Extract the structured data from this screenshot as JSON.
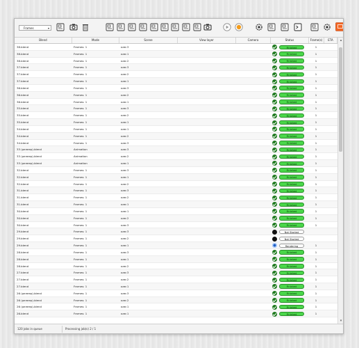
{
  "toolbar": {
    "dropdown_value": "Frames",
    "icons": [
      "add-job-icon",
      "add-folder-icon",
      "delete-icon",
      "clear-icon",
      "select-blend-icon",
      "edit-scene-icon",
      "render-settings-icon",
      "output-folder-icon",
      "image-format-icon",
      "frame-range-icon",
      "samples-icon",
      "split-icon",
      "camera-icon",
      "play-icon",
      "stop-icon",
      "settings-icon",
      "log-icon",
      "report-icon",
      "terminal-icon",
      "preview-icon",
      "folder-open-icon",
      "render-device-icon"
    ]
  },
  "table": {
    "headers": [
      "Blend",
      "Mode",
      "Scene",
      "View layer",
      "Camera",
      "Status",
      "Frame(s)",
      "ETA"
    ],
    "rows": [
      {
        "blend": "38.blend",
        "mode": "Frames: 1",
        "scene": "кам 3",
        "status": "Finished",
        "frames": "1"
      },
      {
        "blend": "38.blend",
        "mode": "Frames: 1",
        "scene": "кам 1",
        "status": "Finished",
        "frames": "1"
      },
      {
        "blend": "38.blend",
        "mode": "Frames: 1",
        "scene": "кам 2",
        "status": "Finished",
        "frames": "1"
      },
      {
        "blend": "37.blend",
        "mode": "Frames: 1",
        "scene": "кам 3",
        "status": "Finished",
        "frames": "1"
      },
      {
        "blend": "37.blend",
        "mode": "Frames: 1",
        "scene": "кам 2",
        "status": "Finished",
        "frames": "1"
      },
      {
        "blend": "37.blend",
        "mode": "Frames: 1",
        "scene": "кам 1",
        "status": "Finished",
        "frames": "1"
      },
      {
        "blend": "36.blend",
        "mode": "Frames: 1",
        "scene": "кам 3",
        "status": "Finished",
        "frames": "1"
      },
      {
        "blend": "36.blend",
        "mode": "Frames: 1",
        "scene": "кам 2",
        "status": "Finished",
        "frames": "1"
      },
      {
        "blend": "36.blend",
        "mode": "Frames: 1",
        "scene": "кам 1",
        "status": "Finished",
        "frames": "1"
      },
      {
        "blend": "35.blend",
        "mode": "Frames: 1",
        "scene": "кам 3",
        "status": "Finished",
        "frames": "1"
      },
      {
        "blend": "35.blend",
        "mode": "Frames: 1",
        "scene": "кам 2",
        "status": "Finished",
        "frames": "1"
      },
      {
        "blend": "35.blend",
        "mode": "Frames: 1",
        "scene": "кам 1",
        "status": "Finished",
        "frames": "1"
      },
      {
        "blend": "34.blend",
        "mode": "Frames: 1",
        "scene": "кам 1",
        "status": "Finished",
        "frames": "1"
      },
      {
        "blend": "34.blend",
        "mode": "Frames: 1",
        "scene": "кам 2",
        "status": "Finished",
        "frames": "1"
      },
      {
        "blend": "34.blend",
        "mode": "Frames: 1",
        "scene": "кам 3",
        "status": "Finished",
        "frames": "1"
      },
      {
        "blend": "33 (релеер).blend",
        "mode": "Animation",
        "scene": "кам 3",
        "status": "Finished",
        "frames": "1"
      },
      {
        "blend": "33 (релеер).blend",
        "mode": "Animation",
        "scene": "кам 2",
        "status": "Finished",
        "frames": "1"
      },
      {
        "blend": "33 (релеер).blend",
        "mode": "Animation",
        "scene": "кам 1",
        "status": "Finished",
        "frames": "1"
      },
      {
        "blend": "32.blend",
        "mode": "Frames: 1",
        "scene": "кам 3",
        "status": "Finished",
        "frames": "1"
      },
      {
        "blend": "32.blend",
        "mode": "Frames: 1",
        "scene": "кам 1",
        "status": "Finished",
        "frames": "1"
      },
      {
        "blend": "32.blend",
        "mode": "Frames: 1",
        "scene": "кам 2",
        "status": "Finished",
        "frames": "1"
      },
      {
        "blend": "31.blend",
        "mode": "Frames: 1",
        "scene": "кам 3",
        "status": "Finished",
        "frames": "1"
      },
      {
        "blend": "31.blend",
        "mode": "Frames: 1",
        "scene": "кам 2",
        "status": "Finished",
        "frames": "1"
      },
      {
        "blend": "31.blend",
        "mode": "Frames: 1",
        "scene": "кам 1",
        "status": "Finished",
        "frames": "1"
      },
      {
        "blend": "30.blend",
        "mode": "Frames: 1",
        "scene": "кам 1",
        "status": "Finished",
        "frames": "1"
      },
      {
        "blend": "30.blend",
        "mode": "Frames: 1",
        "scene": "кам 2",
        "status": "Finished",
        "frames": "1"
      },
      {
        "blend": "30.blend",
        "mode": "Frames: 1",
        "scene": "кам 3",
        "status": "Finished",
        "frames": "1"
      },
      {
        "blend": "29.blend",
        "mode": "Frames: 1",
        "scene": "кам 3",
        "status": "Not Started",
        "frames": ""
      },
      {
        "blend": "29.blend",
        "mode": "Frames: 1",
        "scene": "кам 2",
        "status": "Not Started",
        "frames": ""
      },
      {
        "blend": "29.blend",
        "mode": "Frames: 1",
        "scene": "кам 1",
        "status": "Rendering",
        "frames": "1"
      },
      {
        "blend": "28.blend",
        "mode": "Frames: 1",
        "scene": "кам 3",
        "status": "Finished",
        "frames": "1"
      },
      {
        "blend": "28.blend",
        "mode": "Frames: 1",
        "scene": "кам 1",
        "status": "Finished",
        "frames": "1"
      },
      {
        "blend": "28.blend",
        "mode": "Frames: 1",
        "scene": "кам 2",
        "status": "Finished",
        "frames": "1"
      },
      {
        "blend": "27.blend",
        "mode": "Frames: 1",
        "scene": "кам 3",
        "status": "Finished",
        "frames": "1"
      },
      {
        "blend": "27.blend",
        "mode": "Frames: 1",
        "scene": "кам 2",
        "status": "Finished",
        "frames": "1"
      },
      {
        "blend": "27.blend",
        "mode": "Frames: 1",
        "scene": "кам 1",
        "status": "Finished",
        "frames": "1"
      },
      {
        "blend": "26 (релеер).blend",
        "mode": "Frames: 1",
        "scene": "кам 3",
        "status": "Finished",
        "frames": "1"
      },
      {
        "blend": "26 (релеер).blend",
        "mode": "Frames: 1",
        "scene": "кам 2",
        "status": "Finished",
        "frames": "1"
      },
      {
        "blend": "26 (релеер).blend",
        "mode": "Frames: 1",
        "scene": "кам 1",
        "status": "Finished",
        "frames": "1"
      },
      {
        "blend": "26.blend",
        "mode": "Frames: 1",
        "scene": "кам 1",
        "status": "Finished",
        "frames": "1"
      }
    ]
  },
  "statusbar": {
    "queue": "120 jobs in queue",
    "processing": "Processing job(s) 2 / 1"
  },
  "colors": {
    "finished": "#4ad64a",
    "finished_icon": "#1f7a1f",
    "rendering_icon": "#2160c4",
    "render_button": "#f26522"
  }
}
